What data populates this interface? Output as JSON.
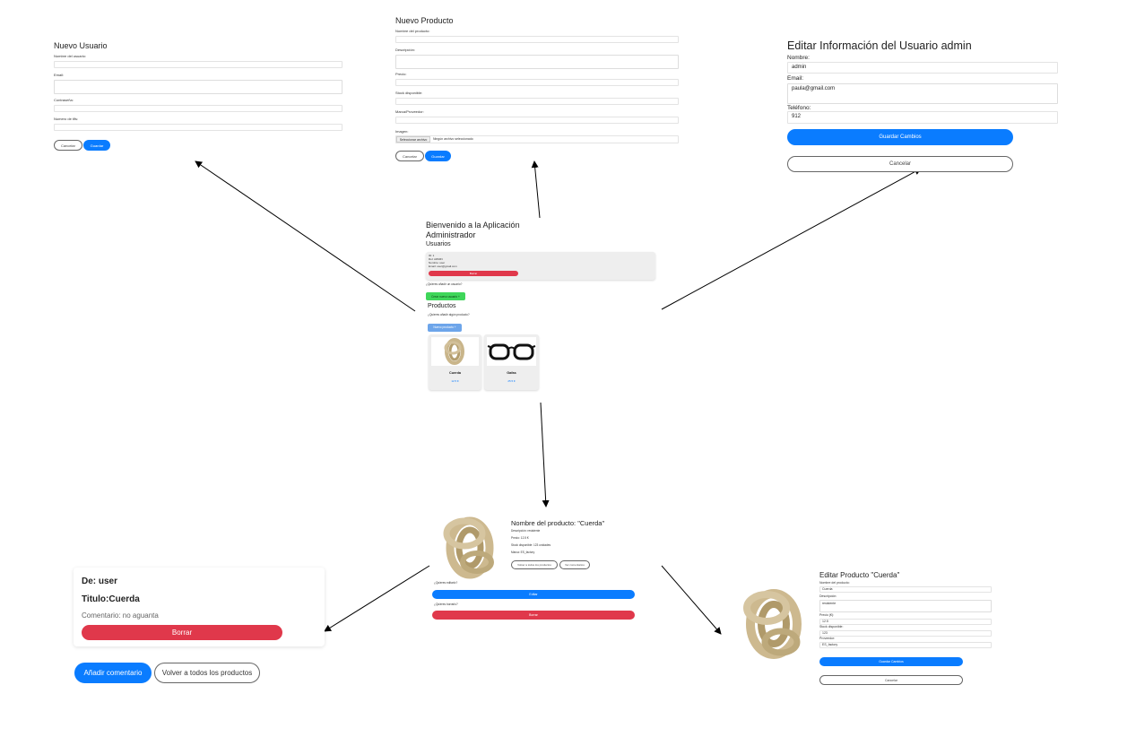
{
  "new_user": {
    "title": "Nuevo Usuario",
    "username_label": "Nombre del usuario:",
    "email_label": "Email:",
    "password_label": "Contraseña:",
    "phone_label": "Numero de tlfs:",
    "cancel_label": "Cancelar",
    "save_label": "Guardar"
  },
  "new_product": {
    "title": "Nuevo Producto",
    "name_label": "Nombre del producto:",
    "description_label": "Descripción:",
    "price_label": "Precio:",
    "stock_label": "Stock disponible:",
    "brand_label": "Marca/Proveedor:",
    "images_label": "Imagen:",
    "file_button_label": "Seleccionar archivo",
    "file_status": "Ningún archivo seleccionado",
    "cancel_label": "Cancelar",
    "save_label": "Guardar"
  },
  "edit_user": {
    "title": "Editar Información del Usuario admin",
    "name_label": "Nombre:",
    "name_value": "admin",
    "email_label": "Email:",
    "email_value": "paula@gmail.com",
    "phone_label": "Teléfono:",
    "phone_value": "912",
    "save_label": "Guardar Cambios",
    "cancel_label": "Cancelar"
  },
  "admin_home": {
    "title_line1": "Bienvenido a la Aplicación",
    "title_line2": "Administrador",
    "users_heading": "Usuarios",
    "user_card_lines": [
      "ID: 1",
      "Rol: ADMIN",
      "Nombre: user",
      "Email: user@gmail.com"
    ],
    "delete_label": "Borrar",
    "add_user_question": "¿Quieres añadir un usuario?",
    "create_user_label": "Crear nuevo usuario +",
    "products_heading": "Productos",
    "add_product_question": "¿Quieres añadir algún producto?",
    "add_product_label": "Nuevo producto +",
    "products": [
      {
        "name": "Cuerda",
        "price": "12.5 €"
      },
      {
        "name": "Gafas",
        "price": "25.5 €"
      }
    ]
  },
  "product_detail": {
    "title": "Nombre del producto: \"Cuerda\"",
    "description": "Descripción: resistente",
    "price": "Precio: 12.5 €",
    "stock": "Stock disponible: 123 unidades",
    "brand": "Marca: ES_factory",
    "back_label": "Volver a todos los productos",
    "comment_label": "Ver comentarios",
    "edit_question": "¿Quieres editarlo?",
    "edit_label": "Editar",
    "delete_question": "¿Quieres borrarlo?",
    "delete_label": "Borrar"
  },
  "comments": {
    "from": "De: user",
    "title": "Titulo:Cuerda",
    "comment": "Comentario: no aguanta",
    "delete_label": "Borrar",
    "add_label": "Añadir comentario",
    "back_label": "Volver a todos los productos"
  },
  "edit_product": {
    "title": "Editar Producto \"Cuerda\"",
    "name_label": "Nombre del producto:",
    "name_value": "Cuerda",
    "description_label": "Descripción:",
    "description_value": "resistente",
    "price_label": "Precio (€):",
    "price_value": "12.5",
    "stock_label": "Stock disponible:",
    "stock_value": "123",
    "brand_label": "Proveedor:",
    "brand_value": "ES_factory",
    "save_label": "Guardar Cambios",
    "cancel_label": "Cancelar"
  },
  "colors": {
    "primary_blue": "#0a7cff",
    "danger_red": "#e0384b",
    "success_green": "#3fd65a",
    "card_gray": "#eeeeee"
  }
}
